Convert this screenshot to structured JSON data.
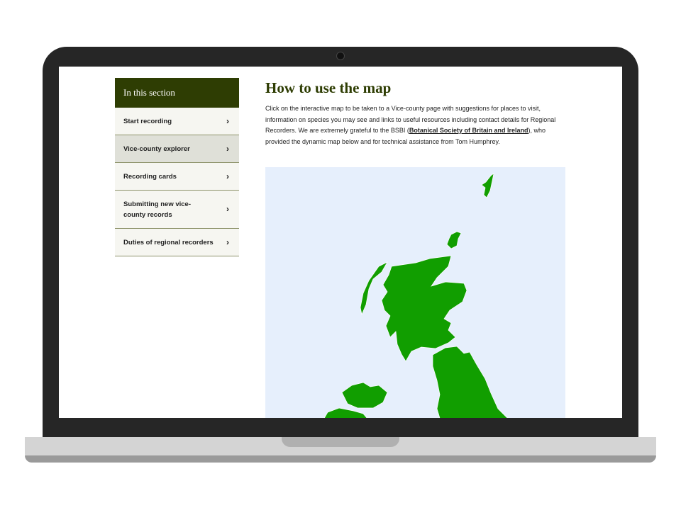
{
  "sidebar": {
    "heading": "In this section",
    "items": [
      {
        "label": "Start recording",
        "active": false
      },
      {
        "label": "Vice-county explorer",
        "active": true
      },
      {
        "label": "Recording cards",
        "active": false
      },
      {
        "label": "Submitting new vice-county records",
        "active": false
      },
      {
        "label": "Duties of regional recorders",
        "active": false
      }
    ],
    "chevron": "›"
  },
  "main": {
    "title": "How to use the map",
    "intro_before": "Click on the interactive map to be taken to a Vice-county page with suggestions for places to visit, information on species you may see and links to useful resources including contact details for Regional Recorders. We are extremely grateful to the BSBI (",
    "intro_link": "Botanical Society of Britain and Ireland",
    "intro_after": "), who provided the dynamic map below and for technical assistance from Tom Humphrey."
  },
  "colors": {
    "brand": "#2e3d03",
    "map_land": "#119e00",
    "map_sea": "#e6effc"
  }
}
